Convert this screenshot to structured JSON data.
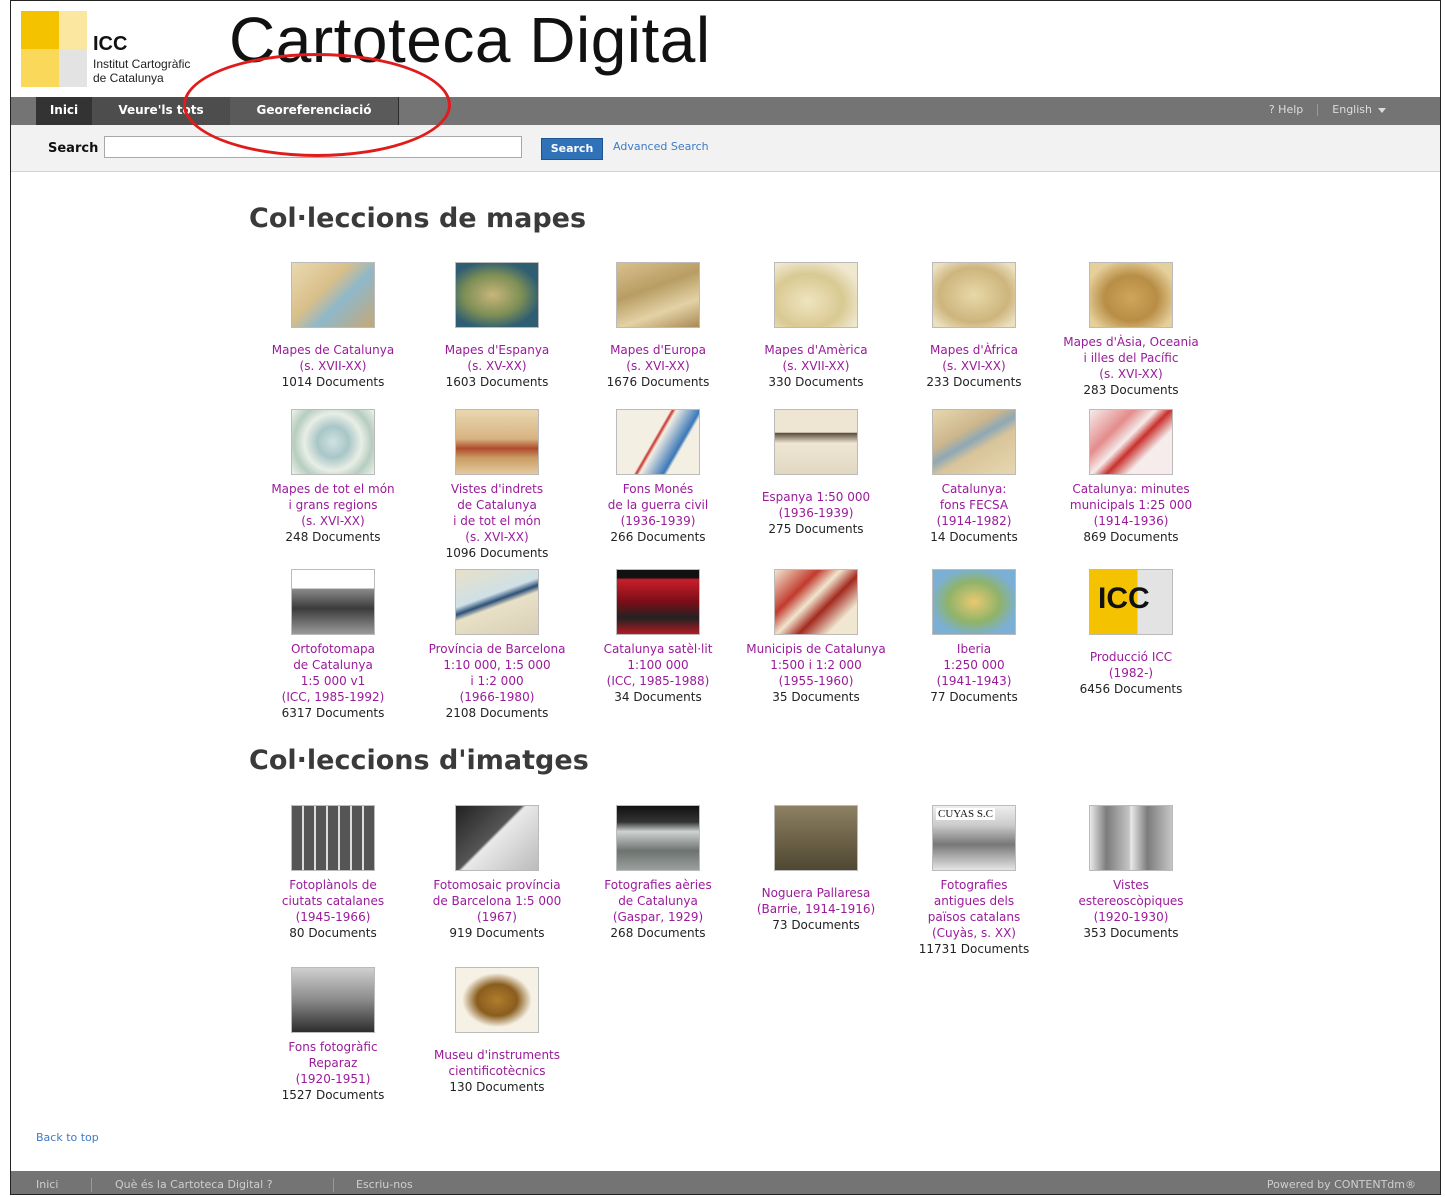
{
  "header": {
    "logo": {
      "acronym": "ICC",
      "name_line1": "Institut Cartogràfic",
      "name_line2": "de Catalunya"
    },
    "site_title": "Cartoteca Digital"
  },
  "nav": {
    "tabs": [
      "Inici",
      "Veure'ls tots",
      "Georeferenciació"
    ],
    "help": "? Help",
    "language": "English"
  },
  "search": {
    "label": "Search",
    "input_value": "",
    "button": "Search",
    "advanced": "Advanced Search"
  },
  "sections": {
    "maps_title": "Col·leccions de mapes",
    "images_title": "Col·leccions d'imatges"
  },
  "maps": [
    {
      "title": [
        "Mapes de Catalunya",
        "(s. XVII-XX)"
      ],
      "count": "1014 Documents",
      "thumb": "catalonia-map"
    },
    {
      "title": [
        "Mapes d'Espanya",
        "(s. XV-XX)"
      ],
      "count": "1603 Documents",
      "thumb": "spain-map"
    },
    {
      "title": [
        "Mapes d'Europa",
        "(s. XVI-XX)"
      ],
      "count": "1676 Documents",
      "thumb": "europe-map"
    },
    {
      "title": [
        "Mapes d'Amèrica",
        "(s. XVII-XX)"
      ],
      "count": "330 Documents",
      "thumb": "america-map"
    },
    {
      "title": [
        "Mapes d'Àfrica",
        "(s. XVI-XX)"
      ],
      "count": "233 Documents",
      "thumb": "africa-map"
    },
    {
      "title": [
        "Mapes d'Àsia, Oceania",
        "i illes del Pacífic",
        "(s. XVI-XX)"
      ],
      "count": "283 Documents",
      "thumb": "asia-map"
    },
    {
      "title": [
        "Mapes de tot el món",
        "i grans regions",
        "(s. XVI-XX)"
      ],
      "count": "248 Documents",
      "thumb": "world-map"
    },
    {
      "title": [
        "Vistes d'indrets",
        "de Catalunya",
        "i de tot el món",
        "(s. XVI-XX)"
      ],
      "count": "1096 Documents",
      "thumb": "city-view"
    },
    {
      "title": [
        "Fons Monés",
        "de la guerra civil",
        "(1936-1939)"
      ],
      "count": "266 Documents",
      "thumb": "civil-war-map"
    },
    {
      "title": [
        "Espanya 1:50 000",
        "(1936-1939)"
      ],
      "count": "275 Documents",
      "thumb": "sheet-map"
    },
    {
      "title": [
        "Catalunya:",
        "fons FECSA",
        "(1914-1982)"
      ],
      "count": "14 Documents",
      "thumb": "river-map"
    },
    {
      "title": [
        "Catalunya: minutes",
        "municipals 1:25 000",
        "(1914-1936)"
      ],
      "count": "869 Documents",
      "thumb": "municipal-map"
    },
    {
      "title": [
        "Ortofotomapa",
        "de Catalunya",
        "1:5 000 v1",
        "(ICC, 1985-1992)"
      ],
      "count": "6317 Documents",
      "thumb": "orthophoto"
    },
    {
      "title": [
        "Província de Barcelona",
        "1:10 000, 1:5 000",
        "i 1:2 000",
        "(1966-1980)"
      ],
      "count": "2108 Documents",
      "thumb": "province-map"
    },
    {
      "title": [
        "Catalunya satèl·lit",
        "1:100 000",
        "(ICC, 1985-1988)"
      ],
      "count": "34 Documents",
      "thumb": "satellite"
    },
    {
      "title": [
        "Municipis de Catalunya",
        "1:500 i 1:2 000",
        "(1955-1960)"
      ],
      "count": "35 Documents",
      "thumb": "urban-map"
    },
    {
      "title": [
        "Iberia",
        "1:250 000",
        "(1941-1943)"
      ],
      "count": "77 Documents",
      "thumb": "iberia-map"
    },
    {
      "title": [
        "Producció ICC",
        "(1982-)"
      ],
      "count": "6456 Documents",
      "thumb": "icc-logo",
      "thumb_text": "ICC"
    }
  ],
  "images": [
    {
      "title": [
        "Fotoplànols de",
        "ciutats catalanes",
        "(1945-1966)"
      ],
      "count": "80 Documents",
      "thumb": "photo-grid"
    },
    {
      "title": [
        "Fotomosaic província",
        "de Barcelona 1:5 000",
        "(1967)"
      ],
      "count": "919 Documents",
      "thumb": "photo-mosaic"
    },
    {
      "title": [
        "Fotografies aèries",
        "de Catalunya",
        "(Gaspar, 1929)"
      ],
      "count": "268 Documents",
      "thumb": "aerial-photo"
    },
    {
      "title": [
        "Noguera Pallaresa",
        "(Barrie, 1914-1916)"
      ],
      "count": "73 Documents",
      "thumb": "landscape-photo"
    },
    {
      "title": [
        "Fotografies",
        "antigues dels",
        "països catalans",
        "(Cuyàs, s. XX)"
      ],
      "count": "11731 Documents",
      "thumb": "old-photo",
      "thumb_text": "CUYAS S.C"
    },
    {
      "title": [
        "Vistes",
        "estereoscòpiques",
        "(1920-1930)"
      ],
      "count": "353 Documents",
      "thumb": "stereo-photo"
    },
    {
      "title": [
        "Fons fotogràfic",
        "Reparaz",
        "(1920-1951)"
      ],
      "count": "1527 Documents",
      "thumb": "photographer"
    },
    {
      "title": [
        "Museu d'instruments",
        "cientificotècnics"
      ],
      "count": "130 Documents",
      "thumb": "instrument"
    }
  ],
  "back_to_top": "Back to top",
  "footer": {
    "links": [
      "Inici",
      "Què és la Cartoteca Digital ?",
      "Escriu-nos"
    ],
    "powered": "Powered by CONTENTdm®"
  }
}
